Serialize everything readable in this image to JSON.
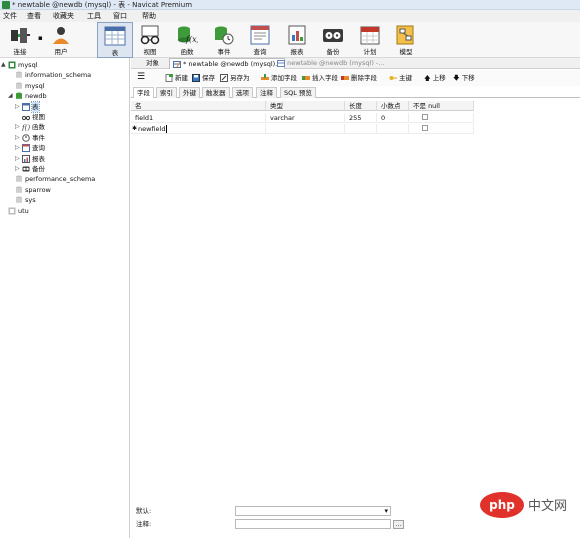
{
  "window": {
    "title": "* newtable @newdb (mysql) - 表 - Navicat Premium"
  },
  "menu": [
    "文件",
    "查看",
    "收藏夹",
    "工具",
    "窗口",
    "帮助"
  ],
  "toolbar": {
    "items": [
      {
        "label": "连接",
        "icon": "plug-icon"
      },
      {
        "label": "用户",
        "icon": "user-icon"
      },
      {
        "label": "表",
        "icon": "table-icon"
      },
      {
        "label": "视图",
        "icon": "glasses-icon"
      },
      {
        "label": "函数",
        "icon": "function-icon"
      },
      {
        "label": "事件",
        "icon": "event-icon"
      },
      {
        "label": "查询",
        "icon": "query-icon"
      },
      {
        "label": "报表",
        "icon": "report-icon"
      },
      {
        "label": "备份",
        "icon": "backup-icon"
      },
      {
        "label": "计划",
        "icon": "calendar-icon"
      },
      {
        "label": "模型",
        "icon": "model-icon"
      }
    ]
  },
  "tree": {
    "items": [
      {
        "label": "mysql",
        "level": 0,
        "expander": "▲"
      },
      {
        "label": "information_schema",
        "level": 1,
        "expander": ""
      },
      {
        "label": "mysql",
        "level": 1,
        "expander": ""
      },
      {
        "label": "newdb",
        "level": 1,
        "expander": "◢"
      },
      {
        "label": "表",
        "level": 2,
        "expander": "▷"
      },
      {
        "label": "视图",
        "level": 2,
        "expander": ""
      },
      {
        "label": "函数",
        "level": 2,
        "expander": "▷"
      },
      {
        "label": "事件",
        "level": 2,
        "expander": "▷"
      },
      {
        "label": "查询",
        "level": 2,
        "expander": "▷"
      },
      {
        "label": "报表",
        "level": 2,
        "expander": "▷"
      },
      {
        "label": "备份",
        "level": 2,
        "expander": "▷"
      },
      {
        "label": "performance_schema",
        "level": 1,
        "expander": ""
      },
      {
        "label": "sparrow",
        "level": 1,
        "expander": ""
      },
      {
        "label": "sys",
        "level": 1,
        "expander": ""
      },
      {
        "label": "utu",
        "level": 0,
        "expander": ""
      }
    ]
  },
  "tabs": {
    "objects": "对象",
    "active": "* newtable @newdb (mysql)...",
    "inactive": "newtable @newdb (mysql) -..."
  },
  "edit_toolbar": {
    "menu_icon": "hamburger-icon",
    "new": "新建",
    "save": "保存",
    "save_as": "另存为",
    "add_field": "添加字段",
    "insert_field": "插入字段",
    "delete_field": "删除字段",
    "primary_key": "主键",
    "move_up": "上移",
    "move_down": "下移"
  },
  "subtabs": [
    "字段",
    "索引",
    "外键",
    "触发器",
    "选项",
    "注释",
    "SQL 预览"
  ],
  "grid": {
    "headers": [
      "名",
      "类型",
      "长度",
      "小数点",
      "不是 null"
    ],
    "rows": [
      {
        "name": "field1",
        "type": "varchar",
        "length": "255",
        "decimals": "0",
        "not_null": false
      },
      {
        "name": "newfield",
        "type": "",
        "length": "",
        "decimals": "",
        "not_null": false
      }
    ]
  },
  "props": {
    "default_label": "默认:",
    "comment_label": "注释:",
    "dropdown_arrow": "▾",
    "ellipsis": "..."
  },
  "watermark": {
    "brand": "php",
    "site": "中文网"
  },
  "colors": {
    "selection": "#cfe3fb",
    "watermark_red": "#e0312b"
  }
}
